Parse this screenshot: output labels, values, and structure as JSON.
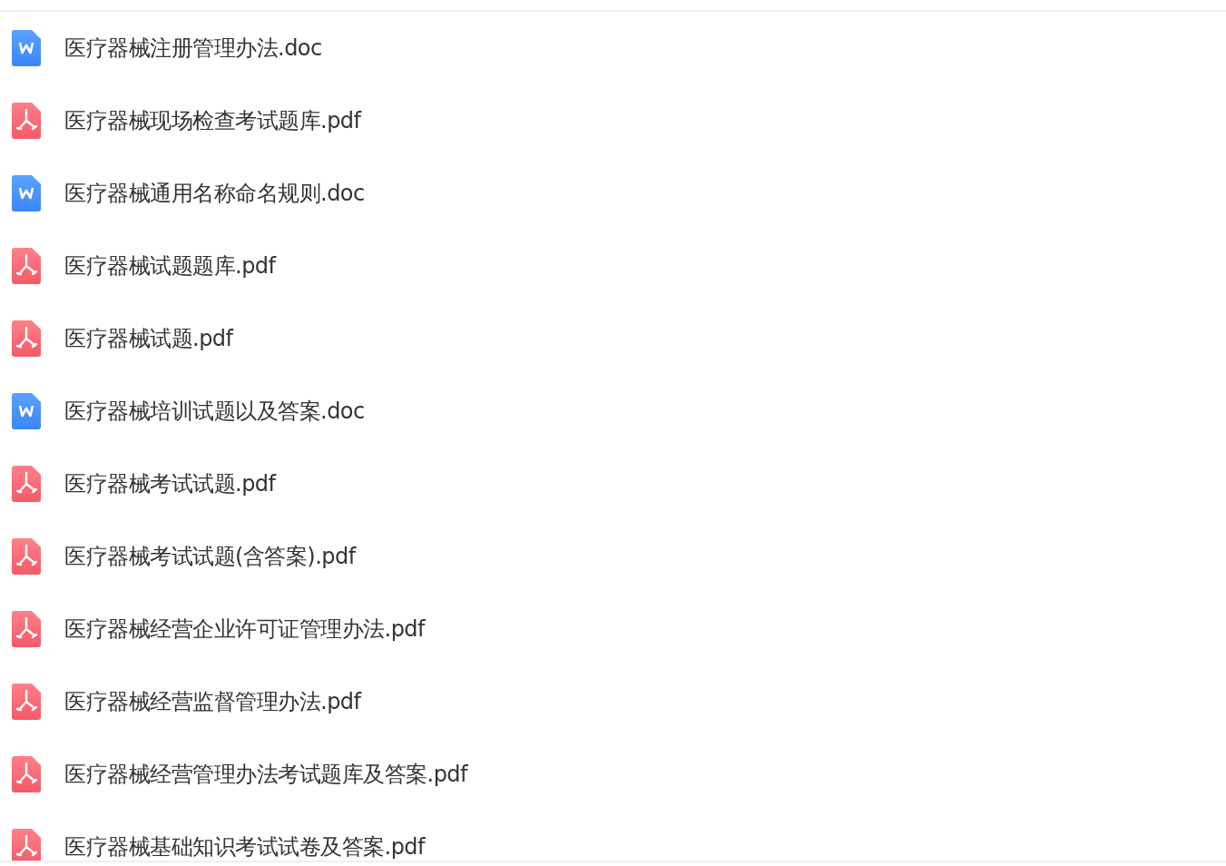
{
  "files": [
    {
      "name": "医疗器械注册管理办法.doc",
      "kind": "word"
    },
    {
      "name": "医疗器械现场检查考试题库.pdf",
      "kind": "pdf"
    },
    {
      "name": "医疗器械通用名称命名规则.doc",
      "kind": "word"
    },
    {
      "name": "医疗器械试题题库.pdf",
      "kind": "pdf"
    },
    {
      "name": "医疗器械试题.pdf",
      "kind": "pdf"
    },
    {
      "name": "医疗器械培训试题以及答案.doc",
      "kind": "word"
    },
    {
      "name": "医疗器械考试试题.pdf",
      "kind": "pdf"
    },
    {
      "name": "医疗器械考试试题(含答案).pdf",
      "kind": "pdf"
    },
    {
      "name": "医疗器械经营企业许可证管理办法.pdf",
      "kind": "pdf"
    },
    {
      "name": "医疗器械经营监督管理办法.pdf",
      "kind": "pdf"
    },
    {
      "name": "医疗器械经营管理办法考试题库及答案.pdf",
      "kind": "pdf"
    },
    {
      "name": "医疗器械基础知识考试试卷及答案.pdf",
      "kind": "pdf"
    }
  ]
}
